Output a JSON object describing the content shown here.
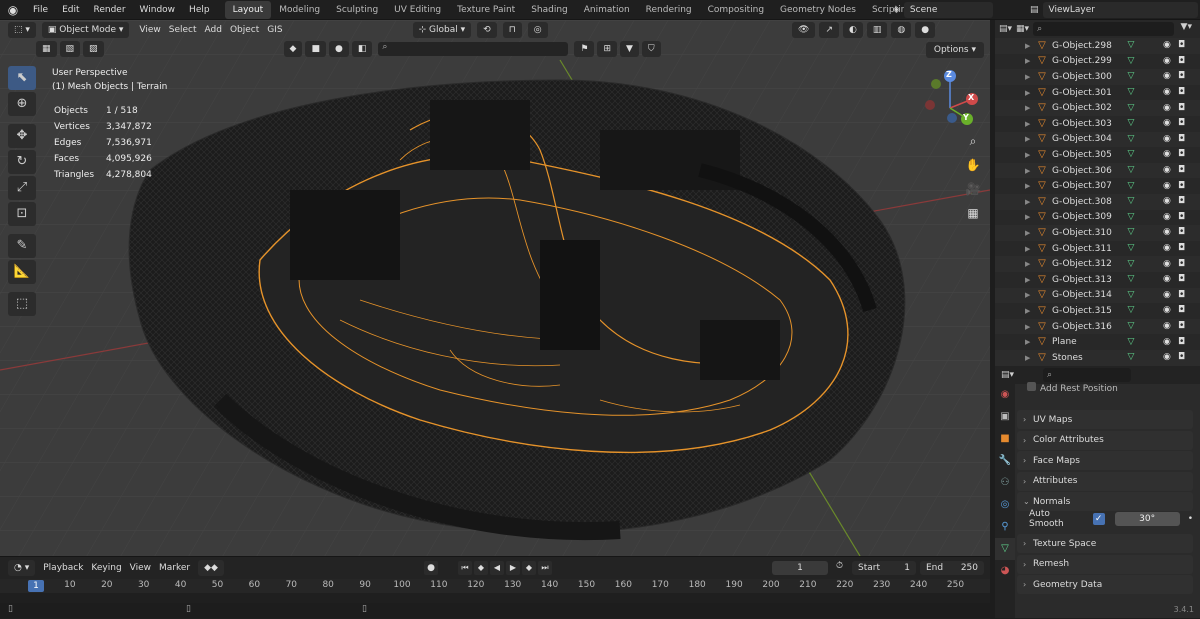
{
  "menu": [
    "File",
    "Edit",
    "Render",
    "Window",
    "Help"
  ],
  "workspaces": [
    "Layout",
    "Modeling",
    "Sculpting",
    "UV Editing",
    "Texture Paint",
    "Shading",
    "Animation",
    "Rendering",
    "Compositing",
    "Geometry Nodes",
    "Scripting"
  ],
  "active_workspace": "Layout",
  "scene": "Scene",
  "view_layer": "ViewLayer",
  "viewport": {
    "mode": "Object Mode",
    "menus": [
      "View",
      "Select",
      "Add",
      "Object",
      "GIS"
    ],
    "orientation": "Global",
    "options_label": "Options",
    "view_name": "User Perspective",
    "collection_info": "(1) Mesh Objects | Terrain",
    "stats": [
      {
        "label": "Objects",
        "value": "1 / 518"
      },
      {
        "label": "Vertices",
        "value": "3,347,872"
      },
      {
        "label": "Edges",
        "value": "7,536,971"
      },
      {
        "label": "Faces",
        "value": "4,095,926"
      },
      {
        "label": "Triangles",
        "value": "4,278,804"
      }
    ],
    "gizmo": {
      "x": "X",
      "y": "Y",
      "z": "Z"
    }
  },
  "timeline": {
    "menus": [
      "Playback",
      "Keying",
      "View",
      "Marker"
    ],
    "current_frame": "1",
    "start_label": "Start",
    "start_value": "1",
    "end_label": "End",
    "end_value": "250",
    "ticks": [
      "10",
      "20",
      "30",
      "40",
      "50",
      "60",
      "70",
      "80",
      "90",
      "100",
      "110",
      "120",
      "130",
      "140",
      "150",
      "160",
      "170",
      "180",
      "190",
      "200",
      "210",
      "220",
      "230",
      "240",
      "250"
    ],
    "cursor_label": "1"
  },
  "outliner": {
    "items": [
      "G-Object.298",
      "G-Object.299",
      "G-Object.300",
      "G-Object.301",
      "G-Object.302",
      "G-Object.303",
      "G-Object.304",
      "G-Object.305",
      "G-Object.306",
      "G-Object.307",
      "G-Object.308",
      "G-Object.309",
      "G-Object.310",
      "G-Object.311",
      "G-Object.312",
      "G-Object.313",
      "G-Object.314",
      "G-Object.315",
      "G-Object.316",
      "Plane",
      "Stones"
    ]
  },
  "properties": {
    "partial_row": "Add Rest Position",
    "sections": [
      "UV Maps",
      "Color Attributes",
      "Face Maps",
      "Attributes",
      "Normals"
    ],
    "auto_smooth_label": "Auto Smooth",
    "auto_smooth_angle": "30°",
    "sections_after": [
      "Texture Space",
      "Remesh",
      "Geometry Data"
    ]
  },
  "version": "3.4.1",
  "colors": {
    "accent": "#4772b3",
    "wire_orange": "#e6932a",
    "mesh_icon": "#5fd38d",
    "object_icon": "#e68a2e"
  }
}
